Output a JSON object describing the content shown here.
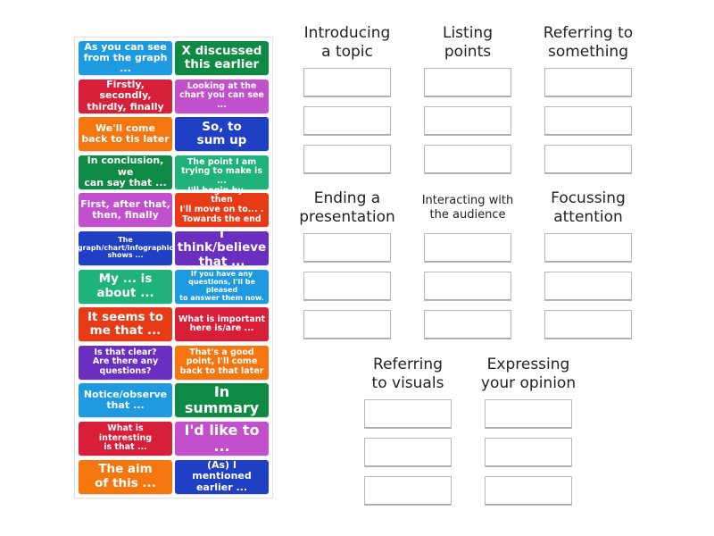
{
  "tiles": [
    {
      "text": "As you can see\nfrom the graph ...",
      "color": "#1e9be0",
      "size": "fs-m"
    },
    {
      "text": "X discussed\nthis earlier",
      "color": "#0e8a45",
      "size": "fs-l"
    },
    {
      "text": "Firstly, secondly,\nthirdly, finally",
      "color": "#d71f3a",
      "size": "fs-m"
    },
    {
      "text": "Looking at the\nchart you can see ...",
      "color": "#c24fcb",
      "size": "fs-s"
    },
    {
      "text": "We'll come\nback to tis later",
      "color": "#f5760e",
      "size": "fs-m"
    },
    {
      "text": "So, to\nsum up",
      "color": "#1f3fc4",
      "size": "fs-l"
    },
    {
      "text": "In conclusion, we\ncan say that ...",
      "color": "#0e8a45",
      "size": "fs-m"
    },
    {
      "text": "The point I am\ntrying to make is ...",
      "color": "#1fb27a",
      "size": "fs-s"
    },
    {
      "text": "First, after that,\nthen, finally",
      "color": "#c24fcb",
      "size": "fs-m"
    },
    {
      "text": "I'll begin by ... then\nI'll move on to... .\nTowards the end ...",
      "color": "#e63b16",
      "size": "fs-s"
    },
    {
      "text": "The\ngraph/chart/infographic\nshows ...",
      "color": "#1f3fc4",
      "size": "fs-xs"
    },
    {
      "text": "I think/believe\nthat ...",
      "color": "#6a2ec0",
      "size": "fs-l"
    },
    {
      "text": "My ... is\nabout ...",
      "color": "#1fb27a",
      "size": "fs-l"
    },
    {
      "text": "If you have any\nquestions, I'll be pleased\nto answer them now.",
      "color": "#1e9be0",
      "size": "fs-xs"
    },
    {
      "text": "It seems to\nme that ...",
      "color": "#e63b16",
      "size": "fs-l"
    },
    {
      "text": "What is important\nhere is/are ...",
      "color": "#d71f3a",
      "size": "fs-s"
    },
    {
      "text": "Is that clear?\nAre there any\nquestions?",
      "color": "#6a2ec0",
      "size": "fs-s"
    },
    {
      "text": "That's a good\npoint, I'll come\nback to that later",
      "color": "#f5760e",
      "size": "fs-s"
    },
    {
      "text": "Notice/observe\nthat ...",
      "color": "#1e9be0",
      "size": "fs-m"
    },
    {
      "text": "In summary",
      "color": "#0e8a45",
      "size": "fs-xl"
    },
    {
      "text": "What is interesting\nis that ...",
      "color": "#d71f3a",
      "size": "fs-s"
    },
    {
      "text": "I'd like to ...",
      "color": "#c24fcb",
      "size": "fs-xl"
    },
    {
      "text": "The aim\nof this ...",
      "color": "#f5760e",
      "size": "fs-l"
    },
    {
      "text": "(As) I mentioned\nearlier ...",
      "color": "#1f3fc4",
      "size": "fs-m"
    }
  ],
  "categories": [
    {
      "title": "Introducing\na topic",
      "slots": 3
    },
    {
      "title": "Listing\npoints",
      "slots": 3
    },
    {
      "title": "Referring to\nsomething",
      "slots": 3
    },
    {
      "title": "Ending a\npresentation",
      "slots": 3
    },
    {
      "title": "Interacting with\nthe audience",
      "slots": 3
    },
    {
      "title": "Focussing\nattention",
      "slots": 3
    },
    {
      "title": "Referring\nto visuals",
      "slots": 3
    },
    {
      "title": "Expressing\nyour opinion",
      "slots": 3
    }
  ]
}
